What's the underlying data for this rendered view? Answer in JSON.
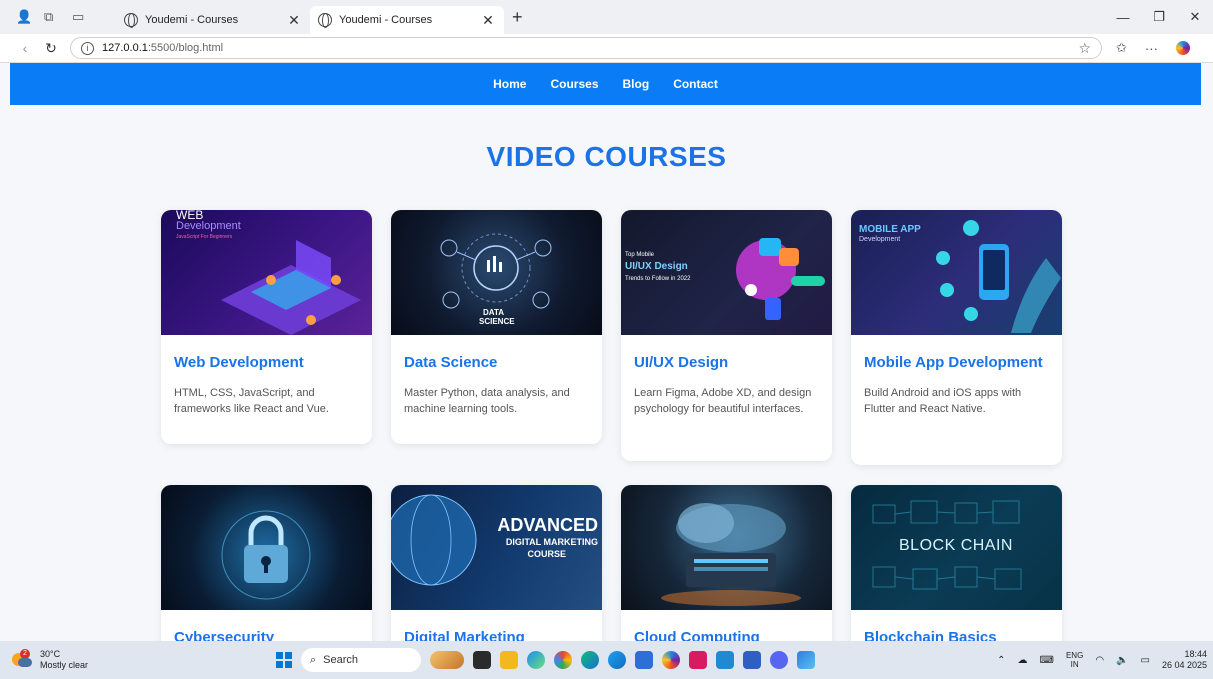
{
  "browser": {
    "tabs": [
      {
        "title": "Youdemi - Courses",
        "active": false
      },
      {
        "title": "Youdemi - Courses",
        "active": true
      }
    ],
    "new_tab_symbol": "+",
    "url_host": "127.0.0.1",
    "url_path": ":5500/blog.html",
    "window_controls": [
      "—",
      "❐",
      "✕"
    ]
  },
  "site": {
    "nav": [
      "Home",
      "Courses",
      "Blog",
      "Contact"
    ],
    "page_title": "VIDEO COURSES",
    "courses": [
      {
        "title": "Web Development",
        "description": "HTML, CSS, JavaScript, and frameworks like React and Vue.",
        "thumb_text": {
          "line1": "WEB",
          "line2": "Development",
          "line3": "JavaScript For Beginners"
        }
      },
      {
        "title": "Data Science",
        "description": "Master Python, data analysis, and machine learning tools.",
        "thumb_text": {
          "line1": "DATA",
          "line2": "SCIENCE"
        }
      },
      {
        "title": "UI/UX Design",
        "description": "Learn Figma, Adobe XD, and design psychology for beautiful interfaces.",
        "thumb_text": {
          "line1": "Top Mobile",
          "line2": "UI/UX Design",
          "line3": "Trends to Follow in 2022"
        }
      },
      {
        "title": "Mobile App Development",
        "description": "Build Android and iOS apps with Flutter and React Native.",
        "thumb_text": {
          "line1": "MOBILE APP",
          "line2": "Development"
        }
      },
      {
        "title": "Cybersecurity",
        "description": "",
        "thumb_text": {}
      },
      {
        "title": "Digital Marketing",
        "description": "",
        "thumb_text": {
          "line1": "ADVANCED",
          "line2": "DIGITAL MARKETING",
          "line3": "COURSE"
        }
      },
      {
        "title": "Cloud Computing",
        "description": "",
        "thumb_text": {}
      },
      {
        "title": "Blockchain Basics",
        "description": "",
        "thumb_text": {
          "line1": "BLOCK CHAIN"
        }
      }
    ]
  },
  "taskbar": {
    "weather_temp": "30°C",
    "weather_desc": "Mostly clear",
    "weather_badge": "2",
    "search_label": "Search",
    "lang_top": "ENG",
    "lang_bottom": "IN",
    "time": "18:44",
    "date": "26 04 2025"
  },
  "colors": {
    "accent": "#1a73e8",
    "nav_bar": "#0a7cf5",
    "page_bg": "#f5f7fa"
  }
}
